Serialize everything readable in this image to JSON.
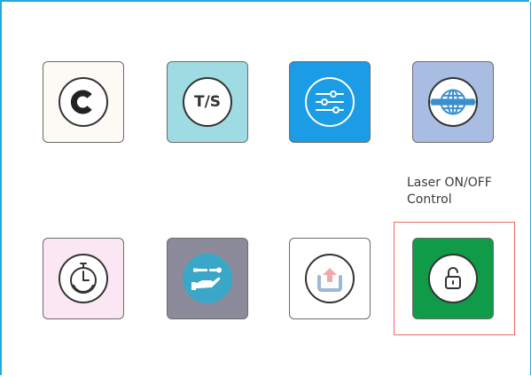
{
  "tiles": [
    {
      "id": "c",
      "text": "C",
      "bg": "#fdf9f4"
    },
    {
      "id": "ts",
      "text": "T/S",
      "bg": "#9fdbe2"
    },
    {
      "id": "settings",
      "bg": "#1b9ce5"
    },
    {
      "id": "network",
      "bg": "#a9bde2"
    },
    {
      "id": "timer",
      "bg": "#fbe6f4"
    },
    {
      "id": "service",
      "bg": "#8c8b9b"
    },
    {
      "id": "upload",
      "bg": "#ffffff"
    },
    {
      "id": "laser",
      "bg": "#0f9b48"
    }
  ],
  "laser_label": {
    "line1": "Laser ON/OFF",
    "line2": "Control"
  },
  "colors": {
    "frame_border": "#29a8dc",
    "highlight_border": "#e86b67",
    "settings_blue": "#1b9ce5",
    "globe_blue": "#3a90cf",
    "wrench_teal": "#3aa7c8",
    "upload_accent": "#f2a9a9",
    "upload_tray": "#9cb8d8"
  },
  "icons": [
    "c-letter-icon",
    "ts-letter-icon",
    "sliders-icon",
    "globe-icon",
    "stopwatch-icon",
    "tools-hand-icon",
    "upload-icon",
    "unlock-icon"
  ]
}
